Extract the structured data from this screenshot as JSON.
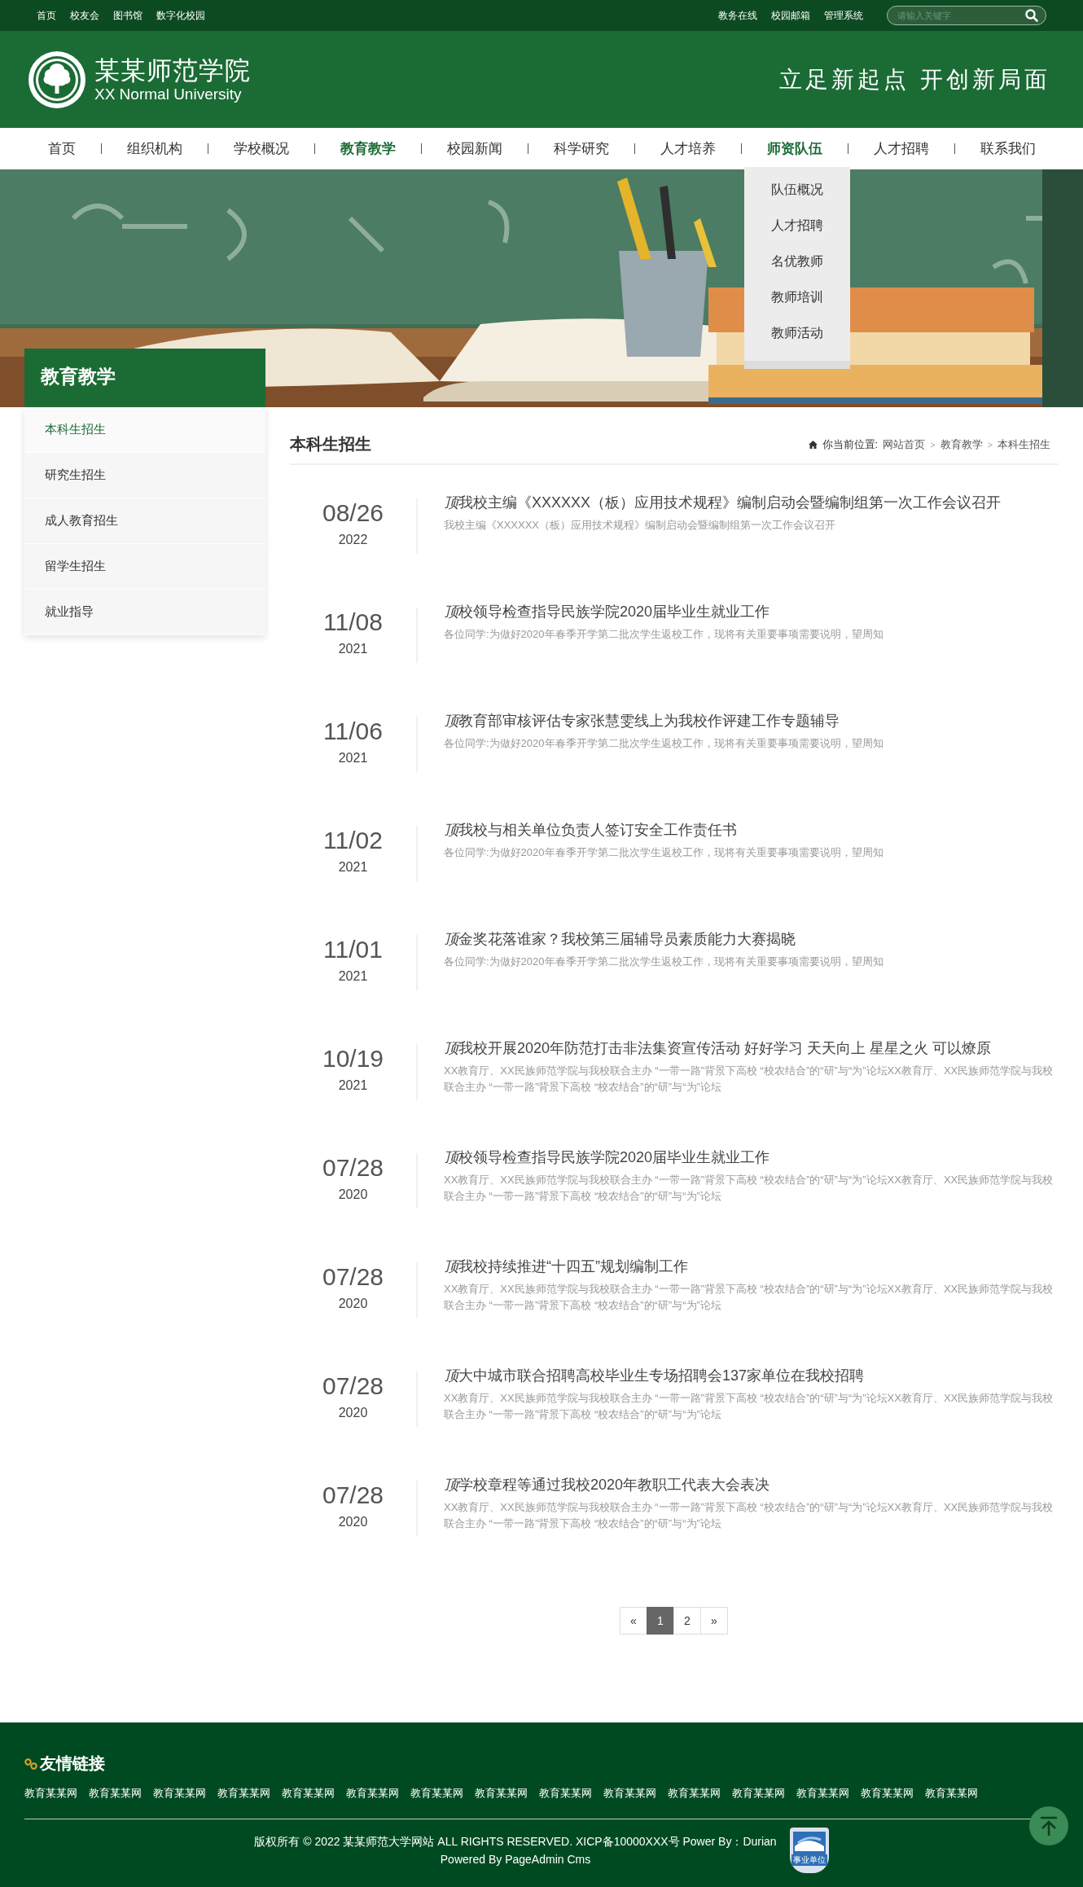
{
  "top_bar": {
    "left_links": [
      "首页",
      "校友会",
      "图书馆",
      "数字化校园"
    ],
    "right_links": [
      "教务在线",
      "校园邮箱",
      "管理系统"
    ],
    "search": {
      "placeholder": "请输入关键字"
    }
  },
  "header": {
    "title": "某某师范学院",
    "subtitle": "XX Normal University",
    "slogan": "立足新起点 开创新局面"
  },
  "nav": [
    {
      "label": "首页",
      "selected": false
    },
    {
      "label": "组织机构",
      "selected": false
    },
    {
      "label": "学校概况",
      "selected": false
    },
    {
      "label": "教育教学",
      "selected": true
    },
    {
      "label": "校园新闻",
      "selected": false
    },
    {
      "label": "科学研究",
      "selected": false
    },
    {
      "label": "人才培养",
      "selected": false
    },
    {
      "label": "师资队伍",
      "expanded": true,
      "children": [
        "队伍概况",
        "人才招聘",
        "名优教师",
        "教师培训",
        "教师活动"
      ]
    },
    {
      "label": "人才招聘",
      "selected": false
    },
    {
      "label": "联系我们",
      "selected": false
    }
  ],
  "sidebar": {
    "title": "教育教学",
    "items": [
      {
        "label": "本科生招生",
        "selected": true
      },
      {
        "label": "研究生招生",
        "selected": false
      },
      {
        "label": "成人教育招生",
        "selected": false
      },
      {
        "label": "留学生招生",
        "selected": false
      },
      {
        "label": "就业指导",
        "selected": false
      }
    ]
  },
  "section_title": "本科生招生",
  "breadcrumb": {
    "label": "你当前位置:",
    "separator": ">",
    "items": [
      "网站首页",
      "教育教学",
      "本科生招生"
    ]
  },
  "news": [
    {
      "date": "08/26",
      "year": "2022",
      "tag": "顶",
      "title": "我校主编《XXXXXX（板）应用技术规程》编制启动会暨编制组第一次工作会议召开",
      "summary": "我校主编《XXXXXX（板）应用技术规程》编制启动会暨编制组第一次工作会议召开"
    },
    {
      "date": "11/08",
      "year": "2021",
      "tag": "顶",
      "title": "校领导检查指导民族学院2020届毕业生就业工作",
      "summary": "各位同学:为做好2020年春季开学第二批次学生返校工作，现将有关重要事项需要说明，望周知"
    },
    {
      "date": "11/06",
      "year": "2021",
      "tag": "顶",
      "title": "教育部审核评估专家张慧雯线上为我校作评建工作专题辅导",
      "summary": "各位同学:为做好2020年春季开学第二批次学生返校工作，现将有关重要事项需要说明，望周知"
    },
    {
      "date": "11/02",
      "year": "2021",
      "tag": "顶",
      "title": "我校与相关单位负责人签订安全工作责任书",
      "summary": "各位同学:为做好2020年春季开学第二批次学生返校工作，现将有关重要事项需要说明，望周知"
    },
    {
      "date": "11/01",
      "year": "2021",
      "tag": "顶",
      "title": "金奖花落谁家？我校第三届辅导员素质能力大赛揭晓",
      "summary": "各位同学:为做好2020年春季开学第二批次学生返校工作，现将有关重要事项需要说明，望周知"
    },
    {
      "date": "10/19",
      "year": "2021",
      "tag": "顶",
      "title": "我校开展2020年防范打击非法集资宣传活动 好好学习 天天向上 星星之火 可以燎原",
      "summary": "XX教育厅、XX民族师范学院与我校联合主办 “一带一路”背景下高校 “校农结合”的“研”与“为”论坛XX教育厅、XX民族师范学院与我校联合主办 “一带一路”背景下高校 “校农结合”的“研”与“为”论坛"
    },
    {
      "date": "07/28",
      "year": "2020",
      "tag": "顶",
      "title": "校领导检查指导民族学院2020届毕业生就业工作",
      "summary": "XX教育厅、XX民族师范学院与我校联合主办 “一带一路”背景下高校 “校农结合”的“研”与“为”论坛XX教育厅、XX民族师范学院与我校联合主办 “一带一路”背景下高校 “校农结合”的“研”与“为”论坛"
    },
    {
      "date": "07/28",
      "year": "2020",
      "tag": "顶",
      "title": "我校持续推进“十四五”规划编制工作",
      "summary": "XX教育厅、XX民族师范学院与我校联合主办 “一带一路”背景下高校 “校农结合”的“研”与“为”论坛XX教育厅、XX民族师范学院与我校联合主办 “一带一路”背景下高校 “校农结合”的“研”与“为”论坛"
    },
    {
      "date": "07/28",
      "year": "2020",
      "tag": "顶",
      "title": "大中城市联合招聘高校毕业生专场招聘会137家单位在我校招聘",
      "summary": "XX教育厅、XX民族师范学院与我校联合主办 “一带一路”背景下高校 “校农结合”的“研”与“为”论坛XX教育厅、XX民族师范学院与我校联合主办 “一带一路”背景下高校 “校农结合”的“研”与“为”论坛"
    },
    {
      "date": "07/28",
      "year": "2020",
      "tag": "顶",
      "title": "学校章程等通过我校2020年教职工代表大会表决",
      "summary": "XX教育厅、XX民族师范学院与我校联合主办 “一带一路”背景下高校 “校农结合”的“研”与“为”论坛XX教育厅、XX民族师范学院与我校联合主办 “一带一路”背景下高校 “校农结合”的“研”与“为”论坛"
    }
  ],
  "pagination": {
    "prev": "«",
    "pages": [
      {
        "label": "1",
        "selected": true
      },
      {
        "label": "2",
        "selected": false
      }
    ],
    "next": "»"
  },
  "footer": {
    "links_title": "友情链接",
    "links": [
      "教育某某网",
      "教育某某网",
      "教育某某网",
      "教育某某网",
      "教育某某网",
      "教育某某网",
      "教育某某网",
      "教育某某网",
      "教育某某网",
      "教育某某网",
      "教育某某网",
      "教育某某网",
      "教育某某网",
      "教育某某网",
      "教育某某网"
    ],
    "copyright": "版权所有 © 2022 某某师范大学网站 ALL RIGHTS RESERVED. XICP备10000XXX号 Power By：Durian",
    "powered": "Powered By PageAdmin Cms",
    "badge": "事业单位"
  }
}
